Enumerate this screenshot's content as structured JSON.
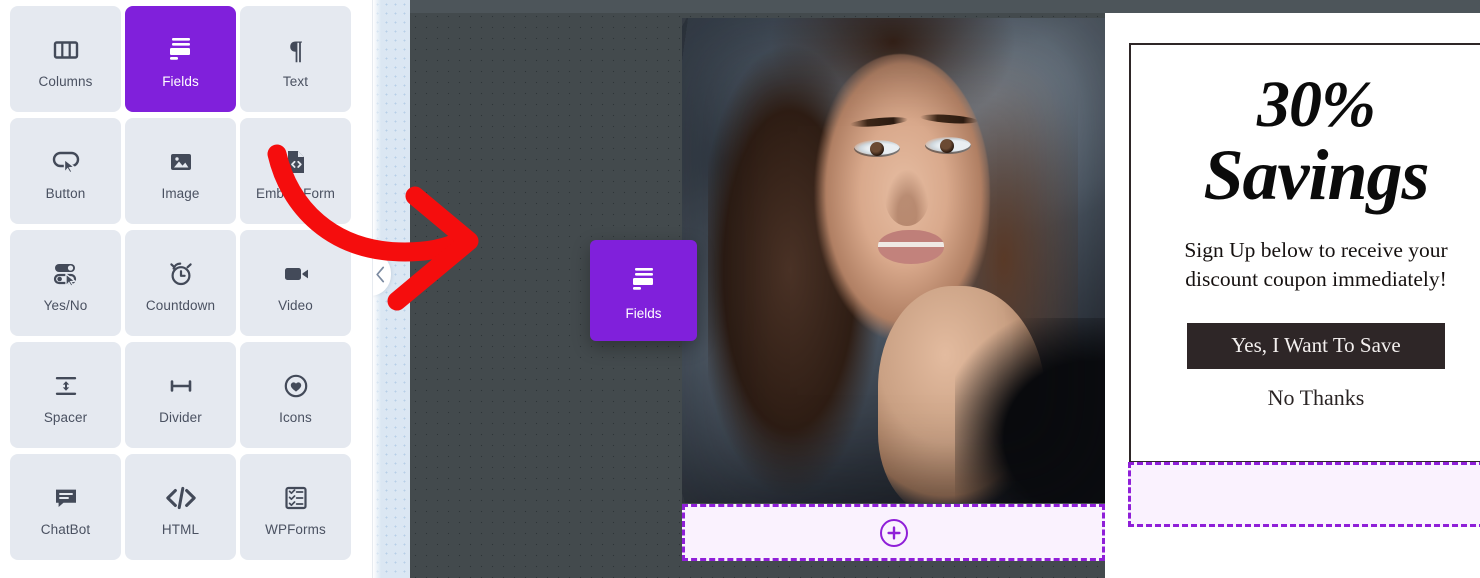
{
  "sidebar": {
    "blocks": [
      {
        "label": "Columns",
        "icon": "columns-icon",
        "active": false
      },
      {
        "label": "Fields",
        "icon": "fields-icon",
        "active": true
      },
      {
        "label": "Text",
        "icon": "paragraph-icon",
        "active": false
      },
      {
        "label": "Button",
        "icon": "button-icon",
        "active": false
      },
      {
        "label": "Image",
        "icon": "image-icon",
        "active": false
      },
      {
        "label": "Embed Form",
        "icon": "embed-form-icon",
        "active": false
      },
      {
        "label": "Yes/No",
        "icon": "yes-no-icon",
        "active": false
      },
      {
        "label": "Countdown",
        "icon": "alarm-clock-icon",
        "active": false
      },
      {
        "label": "Video",
        "icon": "video-camera-icon",
        "active": false
      },
      {
        "label": "Spacer",
        "icon": "spacer-icon",
        "active": false
      },
      {
        "label": "Divider",
        "icon": "divider-icon",
        "active": false
      },
      {
        "label": "Icons",
        "icon": "heart-circle-icon",
        "active": false
      },
      {
        "label": "ChatBot",
        "icon": "chat-bubble-icon",
        "active": false
      },
      {
        "label": "HTML",
        "icon": "code-icon",
        "active": false
      },
      {
        "label": "WPForms",
        "icon": "wpforms-icon",
        "active": false
      }
    ]
  },
  "canvas": {
    "collapse_handle_icon": "chevron-left-icon",
    "drag_ghost": {
      "label": "Fields",
      "icon": "fields-icon"
    },
    "dropzone_main": {
      "icon": "plus-circle-icon"
    },
    "dropzone_side": {
      "icon": ""
    }
  },
  "coupon": {
    "headline_line1": "30%",
    "headline_line2": "Savings",
    "subtext": "Sign Up below to receive your discount coupon immediately!",
    "cta_label": "Yes, I Want To Save",
    "decline_label": "No Thanks"
  },
  "colors": {
    "accent_purple": "#8020db",
    "dropzone_purple": "#8f1fd8",
    "dropzone_fill": "#faf2fe",
    "tile_bg": "#e5e9f0",
    "tile_text": "#4a5161",
    "canvas_dark": "#434a4d",
    "topbar": "#4d555a",
    "coupon_border": "#2e2627",
    "cta_bg": "#2e2627",
    "annotation_red": "#f50d0d"
  },
  "annotation": {
    "arrow_color": "#f50d0d",
    "description": "red curved arrow"
  }
}
